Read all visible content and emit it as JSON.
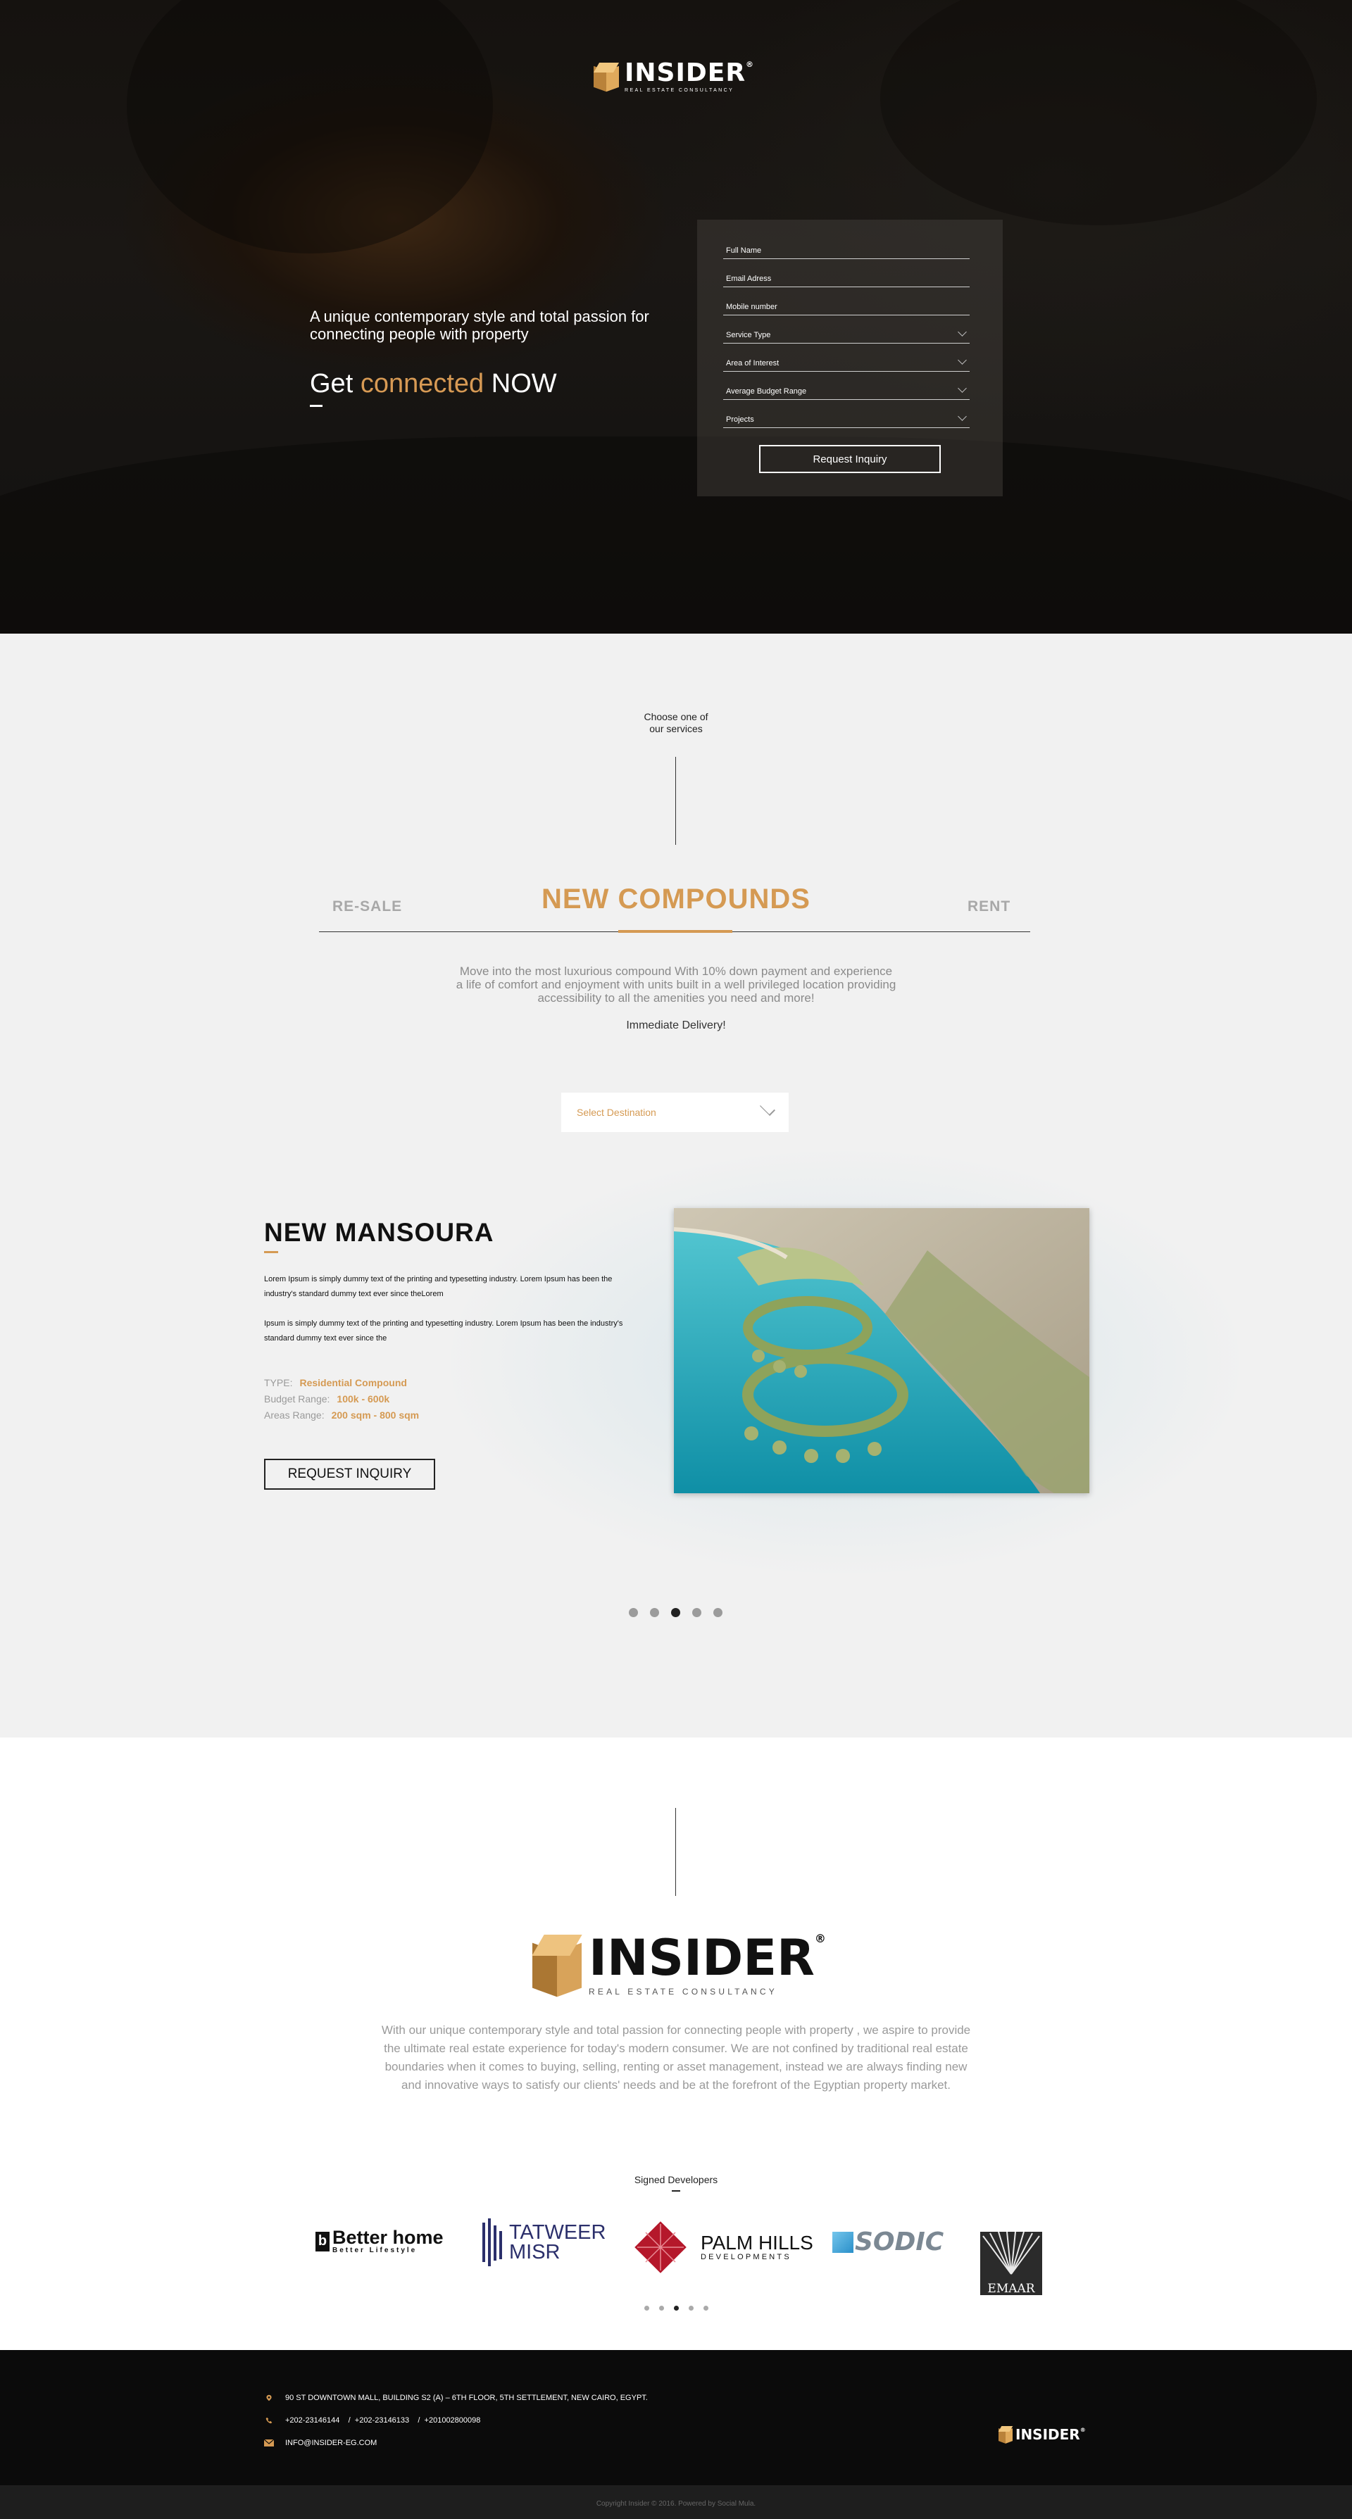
{
  "brand": {
    "name": "INSIDER",
    "tagline": "REAL ESTATE CONSULTANCY",
    "registered": "®",
    "accent_color": "#d59a53"
  },
  "hero": {
    "tagline": "A unique contemporary style and total passion for connecting people with property",
    "cta_prefix": "Get ",
    "cta_accent": "connected",
    "cta_suffix": " NOW"
  },
  "form": {
    "fields": [
      {
        "label": "Full Name",
        "type": "text"
      },
      {
        "label": "Email Adress",
        "type": "text"
      },
      {
        "label": "Mobile number",
        "type": "text"
      },
      {
        "label": "Service Type",
        "type": "select"
      },
      {
        "label": "Area of Interest",
        "type": "select"
      },
      {
        "label": "Average Budget Range",
        "type": "select"
      },
      {
        "label": "Projects",
        "type": "select"
      }
    ],
    "submit_label": "Request Inquiry"
  },
  "services": {
    "choose_line1": "Choose one of",
    "choose_line2": "our services",
    "tabs": [
      "RE-SALE",
      "NEW COMPOUNDS",
      "RENT"
    ],
    "active_tab": "NEW COMPOUNDS",
    "description_lines": [
      "Move into the most luxurious compound With 10% down payment  and experience",
      "a life of comfort and enjoyment with units built in a well privileged location providing",
      "accessibility to all the amenities you need and more!"
    ],
    "delivery": "Immediate Delivery!",
    "destination_placeholder": "Select Destination"
  },
  "project": {
    "title": "NEW MANSOURA",
    "paragraph1": "Lorem Ipsum is simply dummy text of the printing and typesetting industry. Lorem Ipsum has been the industry's standard dummy text ever since theLorem",
    "paragraph2": "Ipsum is simply dummy text of the printing and typesetting industry. Lorem Ipsum has been the industry's standard dummy text ever since the",
    "type_label": "TYPE:",
    "type_value": "Residential Compound",
    "budget_label": "Budget Range:",
    "budget_value": "100k - 600k",
    "area_label": "Areas Range:",
    "area_value": "200 sqm - 800 sqm",
    "inquiry_label": "REQUEST INQUIRY",
    "slider_count": 5,
    "slider_active": 3
  },
  "about": {
    "text": "With our unique contemporary style and total passion for connecting people with property , we aspire to provide the ultimate real estate experience for today's modern consumer. We are not confined by traditional real estate boundaries when it comes to buying, selling, renting or asset management, instead we are always finding new and innovative ways to satisfy our clients' needs and be at the forefront of the Egyptian property market.",
    "developers_title": "Signed Developers",
    "developers": [
      {
        "name": "Better home",
        "sub": "Better Lifestyle",
        "icon": "b-icon"
      },
      {
        "name": "TATWEER",
        "name2": "MISR",
        "icon": "tatweer-bars-icon"
      },
      {
        "name": "PALM HILLS",
        "sub": "DEVELOPMENTS",
        "icon": "diamond-icon"
      },
      {
        "name": "SODIC",
        "icon": "cube-icon"
      },
      {
        "name": "EMAAR",
        "icon": "sunburst-icon"
      }
    ],
    "slider_count": 5,
    "slider_active": 3
  },
  "footer": {
    "address": "90 ST DOWNTOWN MALL, BUILDING S2 (A) – 6TH FLOOR, 5TH SETTLEMENT, NEW CAIRO, EGYPT.",
    "phones": "+202-23146144    /  +202-23146133    /  +201002800098",
    "email": "INFO@INSIDER-EG.COM",
    "copyright": "Copyright Insider © 2016. Powered by Social Mula.",
    "icons": [
      "location-pin-icon",
      "phone-icon",
      "mail-icon"
    ]
  }
}
